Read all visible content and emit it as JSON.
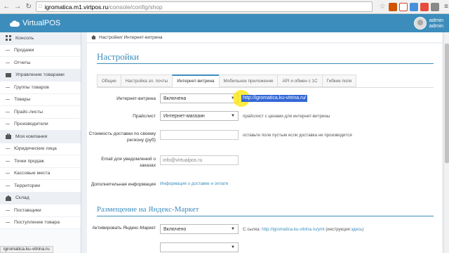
{
  "browser": {
    "url_host": "igromatica.m1.virtpos.ru",
    "url_path": "/console/config/shop"
  },
  "header": {
    "brand": "VirtualPOS",
    "user_name": "admin",
    "user_role": "admin",
    "color": "#3c8dbc"
  },
  "sidebar": {
    "sections": [
      {
        "label": "Консоль",
        "icon": "dashboard-icon",
        "items": [
          "Продажи",
          "Отчеты"
        ]
      },
      {
        "label": "Управление товарами",
        "icon": "boxes-icon",
        "items": [
          "Группы товаров",
          "Товары",
          "Прайс-листы",
          "Производители"
        ]
      },
      {
        "label": "Моя компания",
        "icon": "briefcase-icon",
        "items": [
          "Юридические лица",
          "Точки продаж",
          "Кассовые места",
          "Территории"
        ]
      },
      {
        "label": "Склад",
        "icon": "warehouse-icon",
        "items": [
          "Поставщики",
          "Поступление товара"
        ]
      }
    ]
  },
  "breadcrumb": "Настройки/ Интернет-витрина",
  "main": {
    "title": "Настройки",
    "tabs": [
      "Общие",
      "Настройка эл. почты",
      "Интернет-витрина",
      "Мобильное приложение",
      "API и обмен с 1С",
      "Гибкие поля"
    ],
    "active_tab": 2
  },
  "form": {
    "shop": {
      "label": "Интернет-витрина",
      "value": "Включена",
      "link": "http://igromatica.ku-vitrina.ru/"
    },
    "pricelist": {
      "label": "Прайслист",
      "value": "Интернет-магазин",
      "hint": "прайслист с ценами для интернет-витрины"
    },
    "delivery": {
      "label": "Стоимость доставки по своему региону (руб)",
      "value": "",
      "hint": "оставьте поле пустым если доставка не производится"
    },
    "email": {
      "label": "Email для уведомлений о заказах",
      "placeholder": "info@virtualpos.ru"
    },
    "info": {
      "label": "Дополнительная информация",
      "link": "Информация о доставке и оплате"
    }
  },
  "yandex": {
    "title": "Размещение на Яндекс-Маркет",
    "activate": {
      "label": "Активировать Яндекс-Маркет",
      "value": "Включено",
      "link_prefix": "С сылка:",
      "link": "http://igromatica.ku-vitrina.ru/yml",
      "instruction_prefix": "(инструкция:",
      "instruction_link": "здесь",
      "instruction_suffix": ")"
    }
  },
  "status_url": "igromatica.ku-vitrina.ru"
}
